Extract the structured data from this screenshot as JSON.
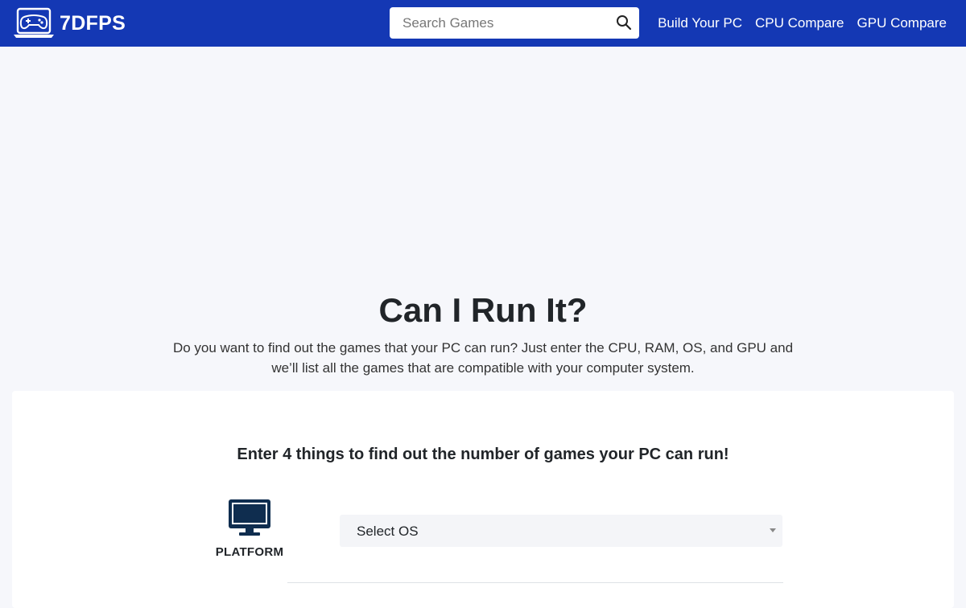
{
  "header": {
    "brand": "7DFPS",
    "search_placeholder": "Search Games",
    "nav": [
      {
        "label": "Build Your PC"
      },
      {
        "label": "CPU Compare"
      },
      {
        "label": "GPU Compare"
      }
    ]
  },
  "hero": {
    "title": "Can I Run It?",
    "description": "Do you want to find out the games that your PC can run? Just enter the CPU, RAM, OS, and GPU and we’ll list all the games that are compatible with your computer system."
  },
  "form": {
    "heading": "Enter 4 things to find out the number of games your PC can run!",
    "platform_label": "PLATFORM",
    "os_select_value": "Select OS"
  },
  "colors": {
    "navbar": "#1438b4",
    "page_background": "#f6f7fb",
    "icon_dark": "#0f2d4f"
  },
  "icons": {
    "brand": "gamepad-laptop-icon",
    "search": "search-icon",
    "platform": "monitor-icon",
    "select": "caret-down-icon"
  }
}
